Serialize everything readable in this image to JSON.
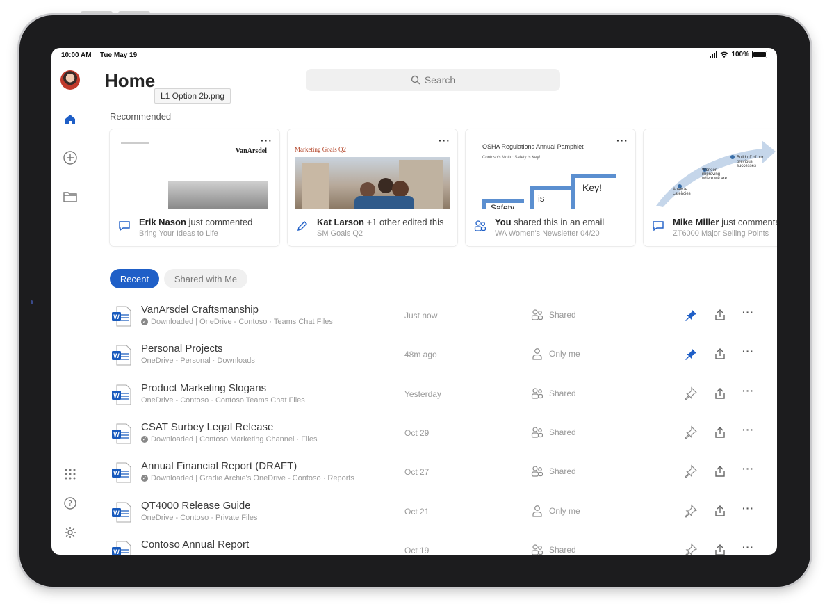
{
  "status_bar": {
    "time": "10:00 AM",
    "date": "Tue May 19",
    "battery": "100%"
  },
  "header": {
    "title": "Home",
    "tooltip": "L1 Option 2b.png",
    "search_placeholder": "Search"
  },
  "recommended": {
    "label": "Recommended",
    "cards": [
      {
        "actor": "Erik Nason",
        "action": " just commented",
        "file": "Bring Your Ideas to Life",
        "activity_icon": "comment-icon",
        "thumb_text": "VanArsdel"
      },
      {
        "actor": "Kat Larson",
        "action": " +1 other edited this",
        "file": "SM Goals Q2",
        "activity_icon": "pencil-icon",
        "thumb_text": "Marketing Goals Q2"
      },
      {
        "actor": "You",
        "action": " shared this in an email",
        "file": "WA Women's Newsletter 04/20",
        "activity_icon": "people-icon",
        "thumb_text": "OSHA Regulations Annual Pamphlet",
        "thumb_sub": "Contoso's Motto: Safety is Key!",
        "thumb_key": "Key!",
        "thumb_is": "is",
        "thumb_safety": "Safety"
      },
      {
        "actor": "Mike Miller",
        "action": " just commented",
        "file": "ZT6000 Major Selling Points",
        "activity_icon": "comment-icon",
        "thumb_a": "Analyze Latencies",
        "thumb_b": "Work on improving where we are",
        "thumb_c": "Build off of our previous successes"
      }
    ]
  },
  "tabs": {
    "recent": "Recent",
    "shared": "Shared with Me"
  },
  "files": [
    {
      "name": "VanArsdel Craftsmanship",
      "location": "Downloaded | OneDrive - Contoso · Teams Chat Files",
      "downloaded": true,
      "when": "Just now",
      "sharing": "Shared",
      "pinned": true
    },
    {
      "name": "Personal Projects",
      "location": "OneDrive - Personal · Downloads",
      "downloaded": false,
      "when": "48m ago",
      "sharing": "Only me",
      "pinned": true
    },
    {
      "name": "Product Marketing Slogans",
      "location": "OneDrive - Contoso · Contoso Teams Chat Files",
      "downloaded": false,
      "when": "Yesterday",
      "sharing": "Shared",
      "pinned": false
    },
    {
      "name": "CSAT Surbey Legal Release",
      "location": "Downloaded | Contoso Marketing Channel · Files",
      "downloaded": true,
      "when": "Oct 29",
      "sharing": "Shared",
      "pinned": false
    },
    {
      "name": "Annual Financial Report (DRAFT)",
      "location": "Downloaded | Gradie Archie's OneDrive - Contoso · Reports",
      "downloaded": true,
      "when": "Oct 27",
      "sharing": "Shared",
      "pinned": false
    },
    {
      "name": "QT4000 Release Guide",
      "location": "OneDrive - Contoso · Private Files",
      "downloaded": false,
      "when": "Oct 21",
      "sharing": "Only me",
      "pinned": false
    },
    {
      "name": "Contoso Annual Report",
      "location": "",
      "downloaded": false,
      "when": "Oct 19",
      "sharing": "Shared",
      "pinned": false
    }
  ],
  "colors": {
    "accent": "#1f5fc7",
    "word": "#185abd",
    "bezel": "#1c1c1e"
  }
}
